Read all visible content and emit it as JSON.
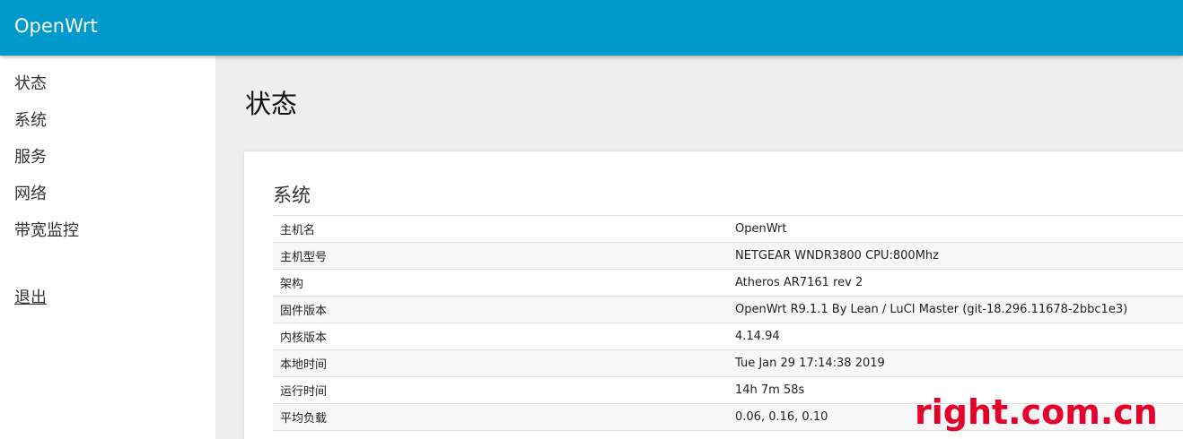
{
  "header": {
    "brand": "OpenWrt"
  },
  "sidebar": {
    "items": [
      {
        "label": "状态"
      },
      {
        "label": "系统"
      },
      {
        "label": "服务"
      },
      {
        "label": "网络"
      },
      {
        "label": "带宽监控"
      }
    ],
    "logout": "退出"
  },
  "main": {
    "title": "状态",
    "section": {
      "title": "系统",
      "rows": [
        {
          "key": "主机名",
          "value": "OpenWrt"
        },
        {
          "key": "主机型号",
          "value": "NETGEAR WNDR3800 CPU:800Mhz"
        },
        {
          "key": "架构",
          "value": "Atheros AR7161 rev 2"
        },
        {
          "key": "固件版本",
          "value": "OpenWrt R9.1.1 By Lean / LuCI Master (git-18.296.11678-2bbc1e3)"
        },
        {
          "key": "内核版本",
          "value": "4.14.94"
        },
        {
          "key": "本地时间",
          "value": "Tue Jan 29 17:14:38 2019"
        },
        {
          "key": "运行时间",
          "value": "14h 7m 58s"
        },
        {
          "key": "平均负载",
          "value": "0.06, 0.16, 0.10"
        }
      ]
    }
  },
  "watermark": "right.com.cn"
}
